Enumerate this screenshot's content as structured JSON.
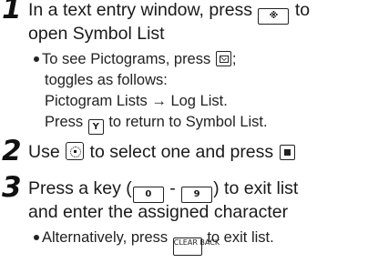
{
  "steps": [
    {
      "number": "1",
      "lines": [
        {
          "before": "In a text entry window, press ",
          "key_name": "symbol-key",
          "key_text": "※",
          "after": " to"
        },
        {
          "text": "open Symbol List"
        }
      ],
      "notes": [
        {
          "before": "To see Pictograms, press ",
          "key_name": "mail-key",
          "after": ";"
        },
        {
          "text": "toggles as follows:"
        },
        {
          "text": "Pictogram Lists → Log List."
        },
        {
          "before": "Press ",
          "key_name": "y-key",
          "key_text": "Y",
          "after": " to return to Symbol List."
        }
      ]
    },
    {
      "number": "2",
      "lines": [
        {
          "before": "Use ",
          "key_name": "nav-key",
          "middle": " to select one and press ",
          "key2_name": "center-key"
        }
      ]
    },
    {
      "number": "3",
      "lines": [
        {
          "before": "Press a key (",
          "key_name": "zero-key",
          "key_text": "0",
          "middle": " - ",
          "key2_name": "nine-key",
          "key2_text": "9",
          "after": ") to exit list"
        },
        {
          "text": "and enter the assigned character"
        }
      ],
      "notes": [
        {
          "before": "Alternatively, press ",
          "key_name": "clear-back-key",
          "key_text": "CLEAR BACK",
          "after": " to exit list."
        }
      ]
    }
  ]
}
